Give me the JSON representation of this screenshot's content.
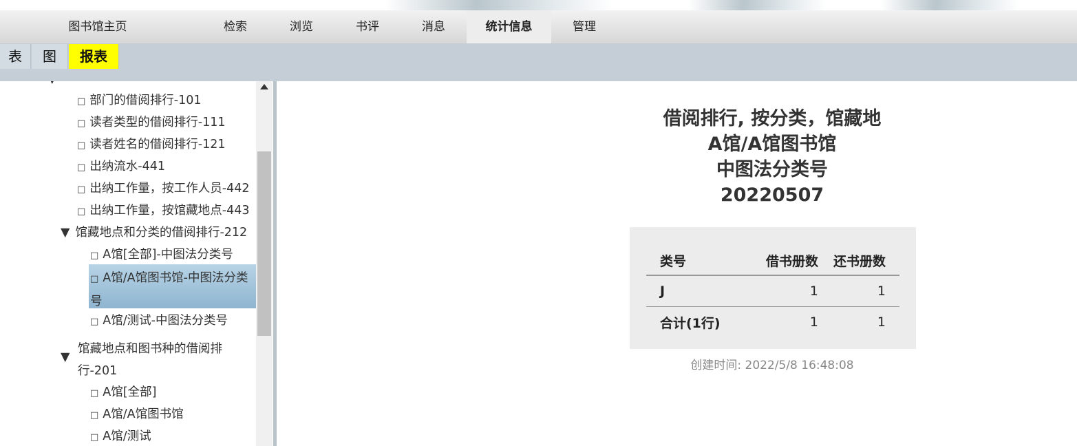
{
  "nav": {
    "items": [
      {
        "label": "图书馆主页"
      },
      {
        "label": "检索"
      },
      {
        "label": "浏览"
      },
      {
        "label": "书评"
      },
      {
        "label": "消息"
      },
      {
        "label": "统计信息"
      },
      {
        "label": "管理"
      }
    ],
    "active_index": 5
  },
  "subtabs": [
    {
      "label": "表"
    },
    {
      "label": "图"
    },
    {
      "label": "报表"
    }
  ],
  "tree": {
    "items": [
      {
        "label": "部门的借阅排行-101"
      },
      {
        "label": "读者类型的借阅排行-111"
      },
      {
        "label": "读者姓名的借阅排行-121"
      },
      {
        "label": "出纳流水-441"
      },
      {
        "label": "出纳工作量，按工作人员-442"
      },
      {
        "label": "出纳工作量，按馆藏地点-443"
      },
      {
        "label": "馆藏地点和分类的借阅排行-212"
      },
      {
        "label": "A馆[全部]-中图法分类号"
      },
      {
        "label": "A馆/A馆图书馆-中图法分类"
      },
      {
        "label": "号"
      },
      {
        "label": "A馆/测试-中图法分类号"
      },
      {
        "label": "馆藏地点和图书种的借阅排"
      },
      {
        "label": "行-201"
      },
      {
        "label": "A馆[全部]"
      },
      {
        "label": "A馆/A馆图书馆"
      },
      {
        "label": "A馆/测试"
      }
    ],
    "expand_glyph": "▼",
    "bullet_glyph": "□",
    "selected_item": "A馆/A馆图书馆-中图法分类号"
  },
  "report": {
    "title_lines": [
      "借阅排行, 按分类，馆藏地",
      "A馆/A馆图书馆",
      "中图法分类号",
      "20220507"
    ],
    "table": {
      "headers": [
        "类号",
        "借书册数",
        "还书册数"
      ],
      "rows": [
        [
          "J",
          "1",
          "1"
        ],
        [
          "合计(1行)",
          "1",
          "1"
        ]
      ]
    },
    "created": "创建时间: 2022/5/8 16:48:08"
  },
  "colors": {
    "active_subtab": "#ffff00",
    "subbar_bg": "#c5ced6",
    "selected_tree_item": "#8fb5d0"
  }
}
